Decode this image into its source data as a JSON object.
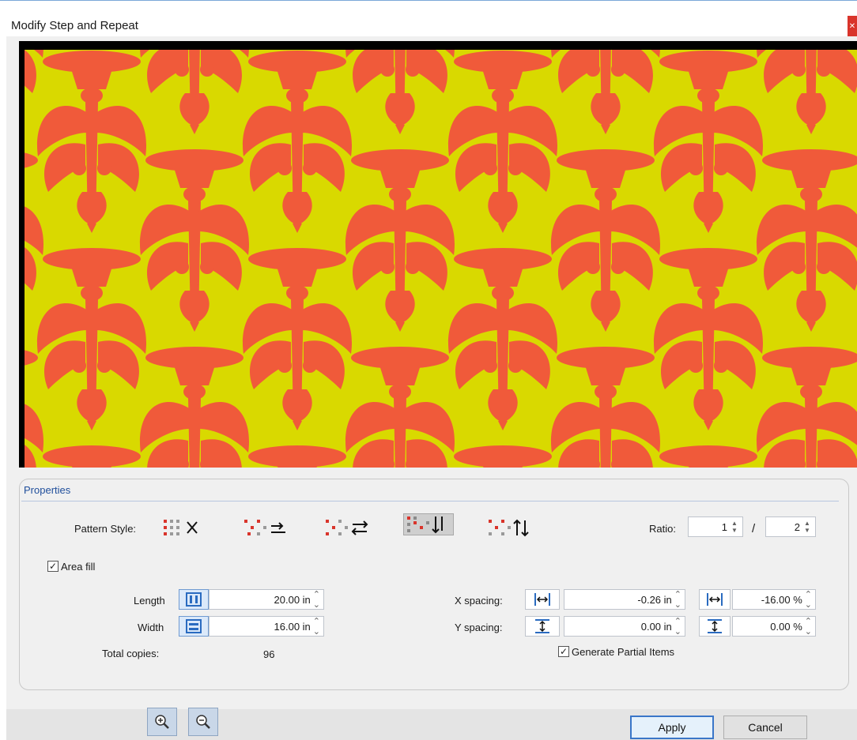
{
  "window": {
    "title": "Modify Step and Repeat"
  },
  "colors": {
    "pattern_background": "#d9d900",
    "pattern_motif": "#f05a3a"
  },
  "properties": {
    "title": "Properties",
    "pattern_style_label": "Pattern Style:",
    "pattern_styles": [
      {
        "icon": "grid-pattern-icon",
        "active": false
      },
      {
        "icon": "brick-right-pattern-icon",
        "active": false
      },
      {
        "icon": "brick-swap-pattern-icon",
        "active": false
      },
      {
        "icon": "half-drop-down-pattern-icon",
        "active": true
      },
      {
        "icon": "half-drop-swap-pattern-icon",
        "active": false
      }
    ],
    "ratio_label": "Ratio:",
    "ratio_numerator": "1",
    "ratio_separator": "/",
    "ratio_denominator": "2",
    "area_fill_label": "Area fill",
    "area_fill_checked": true,
    "length_label": "Length",
    "length_value": "20.00 in",
    "width_label": "Width",
    "width_value": "16.00 in",
    "total_copies_label": "Total copies:",
    "total_copies_value": "96",
    "x_spacing_label": "X spacing:",
    "x_spacing_value": "-0.26 in",
    "x_spacing_percent": "-16.00 %",
    "y_spacing_label": "Y spacing:",
    "y_spacing_value": "0.00 in",
    "y_spacing_percent": "0.00 %",
    "generate_partial_label": "Generate Partial Items",
    "generate_partial_checked": true
  },
  "buttons": {
    "apply": "Apply",
    "cancel": "Cancel"
  }
}
